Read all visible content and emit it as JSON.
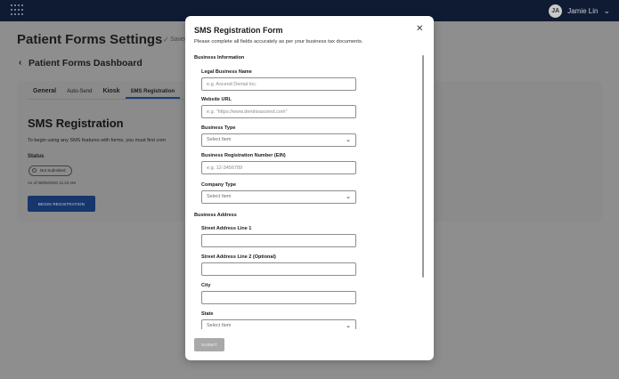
{
  "topbar": {
    "user_initials": "JA",
    "user_name": "Jamie Lin"
  },
  "page": {
    "title": "Patient Forms Settings",
    "saved_text": "Saved",
    "dashboard_link": "Patient Forms Dashboard",
    "tabs": [
      "General",
      "Auto-Send",
      "Kiosk",
      "SMS Registration"
    ],
    "sms": {
      "title": "SMS Registration",
      "description": "To begin using any SMS features with forms, you must first com",
      "status_label": "Status",
      "status_value": "Not Submitted",
      "as_of": "As of 08/05/2020 11:23 AM",
      "begin_button": "BEGIN REGISTRATION"
    }
  },
  "modal": {
    "title": "SMS Registration Form",
    "subtitle": "Please complete all fields accurately as per your business tax documents.",
    "business_info_heading": "Business Information",
    "fields": {
      "legal_name": {
        "label": "Legal Business Name",
        "placeholder": "e.g. Ascend Dental Inc."
      },
      "website": {
        "label": "Website URL",
        "placeholder": "e.g. \"https://www.dentrixascend.com\""
      },
      "business_type": {
        "label": "Business Type",
        "value": "Select Item"
      },
      "ein": {
        "label": "Business Registration Number (EIN)",
        "placeholder": "e.g. 12-3456789"
      },
      "company_type": {
        "label": "Company Type",
        "value": "Select Item"
      }
    },
    "address_heading": "Business Address",
    "address": {
      "street1": {
        "label": "Street Address Line 1",
        "placeholder": ""
      },
      "street2": {
        "label": "Street Address Line 2 (Optional)",
        "placeholder": ""
      },
      "city": {
        "label": "City",
        "placeholder": ""
      },
      "state": {
        "label": "State",
        "value": "Select Item"
      }
    },
    "submit_label": "SUBMIT"
  },
  "colors": {
    "topbar": "#0f1a33",
    "overlay_bg": "#8e8e8e",
    "primary_button": "#17366c",
    "submit_disabled": "#a9a9a9"
  }
}
